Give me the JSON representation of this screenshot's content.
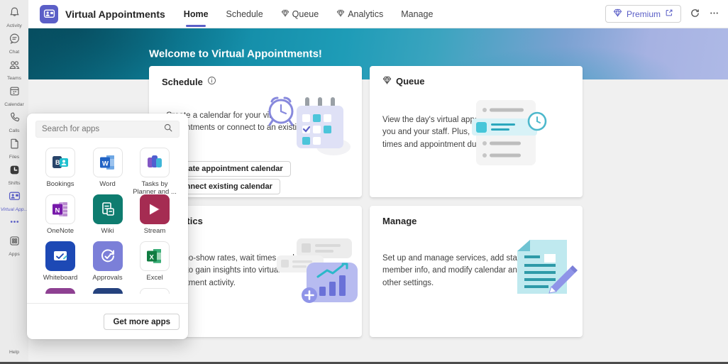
{
  "rail": {
    "items": [
      {
        "label": "Activity",
        "icon": "bell-icon"
      },
      {
        "label": "Chat",
        "icon": "chat-icon"
      },
      {
        "label": "Teams",
        "icon": "teams-icon"
      },
      {
        "label": "Calendar",
        "icon": "calendar-icon"
      },
      {
        "label": "Calls",
        "icon": "phone-icon"
      },
      {
        "label": "Files",
        "icon": "file-icon"
      },
      {
        "label": "Shifts",
        "icon": "shifts-icon"
      },
      {
        "label": "Virtual App...",
        "icon": "virtual-appointments-icon",
        "active": true
      },
      {
        "label": "...",
        "icon": "more-dots-icon"
      },
      {
        "label": "Apps",
        "icon": "apps-grid-icon"
      }
    ],
    "help": {
      "label": "Help",
      "icon": "help-icon"
    }
  },
  "header": {
    "app_title": "Virtual Appointments",
    "tabs": [
      {
        "label": "Home",
        "active": true
      },
      {
        "label": "Schedule"
      },
      {
        "label": "Queue",
        "premium": true
      },
      {
        "label": "Analytics",
        "premium": true
      },
      {
        "label": "Manage"
      }
    ],
    "premium_button": "Premium"
  },
  "banner": {
    "title": "Welcome to Virtual Appointments!"
  },
  "cards": {
    "schedule": {
      "title": "Schedule",
      "body": "Create a calendar for your virtual appointments or connect to an existing one.",
      "buttons": [
        "Create appointment calendar",
        "Connect existing calendar"
      ]
    },
    "queue": {
      "title": "Queue",
      "premium": true,
      "body": "View the day's virtual appointments for you and your staff. Plus, monitor wait times and appointment duration."
    },
    "analytics": {
      "title": "Analytics",
      "premium": true,
      "body": "Track no-show rates, wait times, and usage to gain insights into virtual appointment activity."
    },
    "manage": {
      "title": "Manage",
      "body": "Set up and manage services, add staff member info, and modify calendar and other settings."
    }
  },
  "popup": {
    "search_placeholder": "Search for apps",
    "apps": [
      {
        "name": "Bookings",
        "tile": "#ffffff"
      },
      {
        "name": "Word",
        "tile": "#ffffff"
      },
      {
        "name": "Tasks by Planner and ...",
        "tile": "#ffffff"
      },
      {
        "name": "OneNote",
        "tile": "#ffffff"
      },
      {
        "name": "Wiki",
        "tile": "#0e7c6f"
      },
      {
        "name": "Stream",
        "tile": "#a52c52"
      },
      {
        "name": "Whiteboard",
        "tile": "#1d49b5"
      },
      {
        "name": "Approvals",
        "tile": "#7b7fd8"
      },
      {
        "name": "Excel",
        "tile": "#ffffff"
      }
    ],
    "get_more_apps": "Get more apps"
  },
  "colors": {
    "accent": "#5b5fc7",
    "rail_bg": "#ebebeb",
    "banner_teal": "#1e9cb7",
    "banner_lavender": "#aeb9e6",
    "content_bg": "#f0f0f0"
  }
}
